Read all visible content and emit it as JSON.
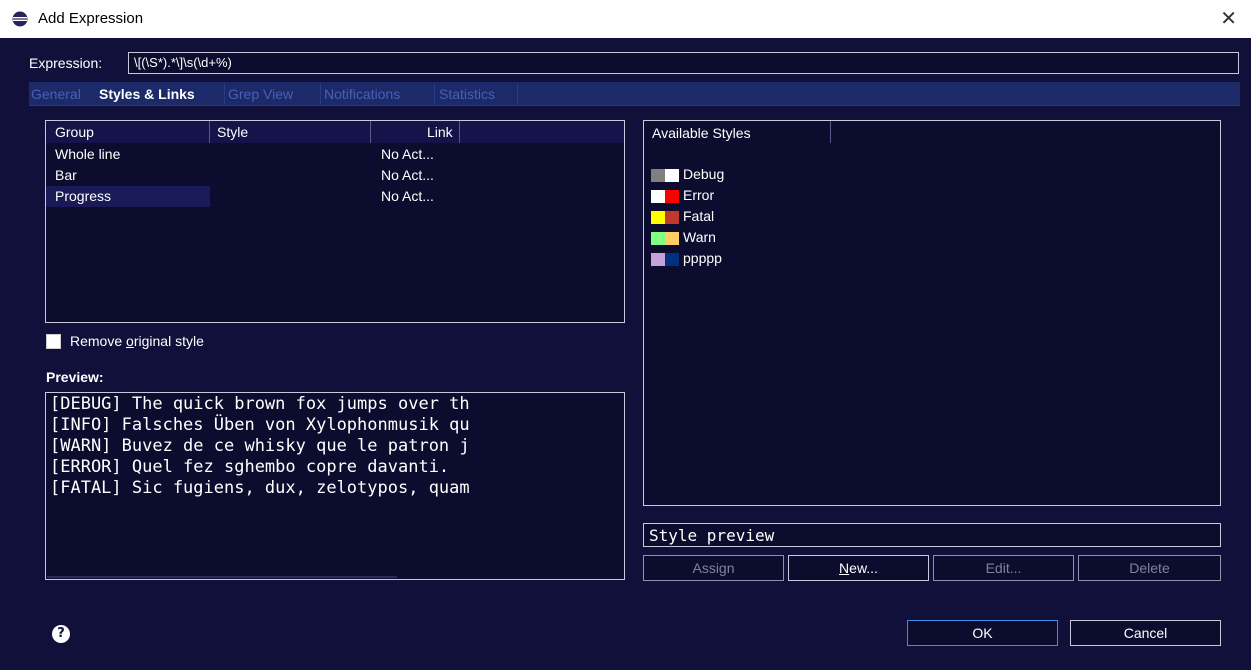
{
  "window": {
    "title": "Add Expression",
    "close_glyph": "✕"
  },
  "expression": {
    "label": "Expression:",
    "value": "\\[(\\S*).*\\]\\s(\\d+%)"
  },
  "tabs": [
    {
      "label": "General",
      "active": false
    },
    {
      "label": "Styles & Links",
      "active": true
    },
    {
      "label": "Grep View",
      "active": false
    },
    {
      "label": "Notifications",
      "active": false
    },
    {
      "label": "Statistics",
      "active": false
    }
  ],
  "group_table": {
    "headers": {
      "group": "Group",
      "style": "Style",
      "link": "Link"
    },
    "rows": [
      {
        "group": "Whole line",
        "style": "",
        "link": "No Act..."
      },
      {
        "group": "Bar",
        "style": "",
        "link": "No Act..."
      },
      {
        "group": "Progress",
        "style": "",
        "link": "No Act...",
        "selected": true
      }
    ]
  },
  "remove_original": {
    "label_pre": "Remove ",
    "label_mnemonic": "o",
    "label_post": "riginal style",
    "checked": false
  },
  "preview": {
    "label": "Preview:",
    "lines": [
      "[DEBUG] The quick brown fox jumps over th",
      "[INFO] Falsches Üben von Xylophonmusik qu",
      "[WARN] Buvez de ce whisky que le patron j",
      "[ERROR] Quel fez sghembo copre davanti.",
      "[FATAL] Sic fugiens, dux, zelotypos, quam"
    ]
  },
  "available_styles": {
    "header": "Available Styles",
    "items": [
      {
        "name": "Debug",
        "fg": "#808080",
        "bg": "#ffffff"
      },
      {
        "name": "Error",
        "fg": "#ffffff",
        "bg": "#ff0000"
      },
      {
        "name": "Fatal",
        "fg": "#ffff00",
        "bg": "#c0392b"
      },
      {
        "name": "Warn",
        "fg": "#80ff80",
        "bg": "#ffcc66"
      },
      {
        "name": "ppppp",
        "fg": "#c8a0d8",
        "bg": "#003080"
      }
    ]
  },
  "style_preview": {
    "text": "Style preview"
  },
  "style_buttons": {
    "assign": "Assign",
    "new_mnemonic": "N",
    "new_rest": "ew...",
    "edit": "Edit...",
    "delete": "Delete"
  },
  "footer": {
    "help_glyph": "?",
    "ok": "OK",
    "cancel": "Cancel"
  },
  "colors": {
    "dialog_bg": "#10103a",
    "tab_bar_bg": "#1c2a6a",
    "inactive_tab": "#4b5fb3",
    "border": "#c8c8d8",
    "default_button_border": "#3a8ee6"
  }
}
